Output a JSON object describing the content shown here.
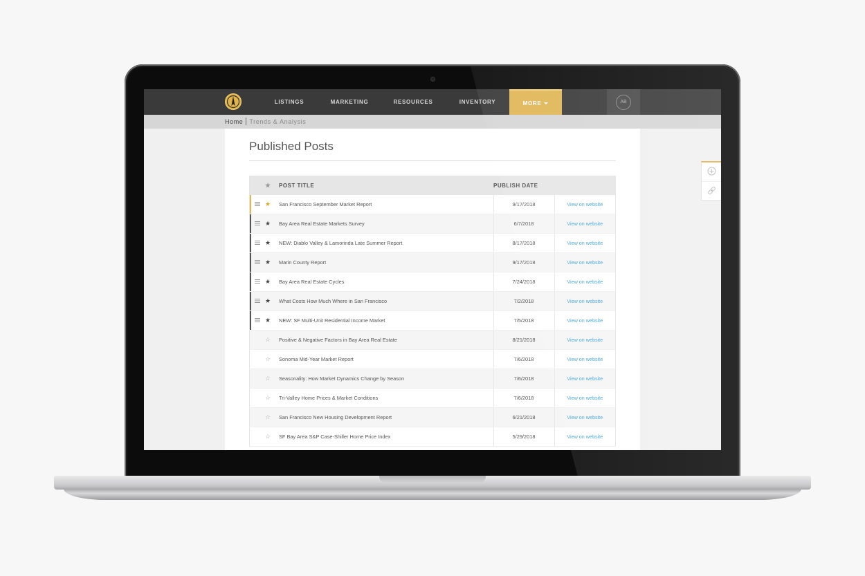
{
  "app": {
    "avatar_initials": "AB"
  },
  "nav": {
    "items": [
      "LISTINGS",
      "MARKETING",
      "RESOURCES",
      "INVENTORY"
    ],
    "more_label": "MORE"
  },
  "breadcrumb": {
    "home": "Home",
    "current": "Trends & Analysis"
  },
  "page": {
    "title": "Published Posts"
  },
  "table": {
    "headers": {
      "title": "POST TITLE",
      "date": "PUBLISH DATE"
    },
    "rows": [
      {
        "title": "San Francisco September Market Report",
        "date": "9/17/2018",
        "link": "View on website",
        "starred": true
      },
      {
        "title": "Bay Area Real Estate Markets Survey",
        "date": "6/7/2018",
        "link": "View on website",
        "starred": true
      },
      {
        "title": "NEW: Diablo Valley & Lamorinda Late Summer Report",
        "date": "8/17/2018",
        "link": "View on website",
        "starred": true
      },
      {
        "title": "Marin County Report",
        "date": "9/17/2018",
        "link": "View on website",
        "starred": true
      },
      {
        "title": "Bay Area Real Estate Cycles",
        "date": "7/24/2018",
        "link": "View on website",
        "starred": true
      },
      {
        "title": "What Costs How Much Where in San Francisco",
        "date": "7/2/2018",
        "link": "View on website",
        "starred": true
      },
      {
        "title": "NEW: SF Multi-Unit Residential Income Market",
        "date": "7/5/2018",
        "link": "View on website",
        "starred": true
      },
      {
        "title": "Positive & Negative Factors in Bay Area Real Estate",
        "date": "8/21/2018",
        "link": "View on website",
        "starred": false
      },
      {
        "title": "Sonoma Mid-Year Market Report",
        "date": "7/6/2018",
        "link": "View on website",
        "starred": false
      },
      {
        "title": "Seasonality: How Market Dynamics Change by Season",
        "date": "7/6/2018",
        "link": "View on website",
        "starred": false
      },
      {
        "title": "Tri-Valley Home Prices & Market Conditions",
        "date": "7/6/2018",
        "link": "View on website",
        "starred": false
      },
      {
        "title": "San Francisco New Housing Development Report",
        "date": "6/21/2018",
        "link": "View on website",
        "starred": false
      },
      {
        "title": "SF Bay Area S&P Case-Shiller Home Price Index",
        "date": "5/29/2018",
        "link": "View on website",
        "starred": false
      }
    ]
  },
  "icons": {
    "logo": "compass-logo",
    "add": "plus-circle-icon",
    "link": "link-icon",
    "drag": "drag-handle-icon",
    "star": "star-icon"
  },
  "colors": {
    "nav_bg": "#3a3a3a",
    "accent": "#e0b656",
    "link": "#3fa3d8",
    "pin_bar": "#555555"
  }
}
